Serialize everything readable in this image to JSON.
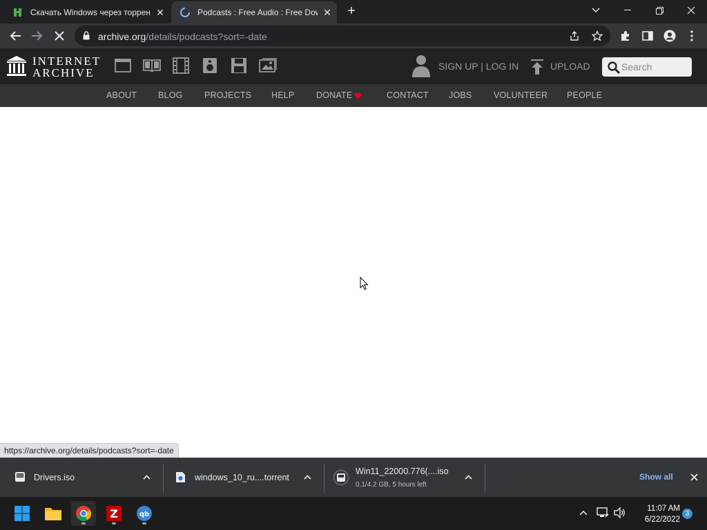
{
  "browser": {
    "tabs": [
      {
        "title": "Скачать Windows через торрент",
        "state": "inactive",
        "favicon": "torrent-site-icon"
      },
      {
        "title": "Podcasts : Free Audio : Free Download",
        "state": "active-loading",
        "favicon": "loading-spinner-icon"
      }
    ],
    "new_tab_label": "+",
    "window_controls": [
      "chevron-down-icon",
      "minimize-icon",
      "restore-icon",
      "close-icon"
    ],
    "url_host": "archive.org",
    "url_path": "/details/podcasts?sort=-date",
    "status_bubble": "https://archive.org/details/podcasts?sort=-date"
  },
  "ia": {
    "logo_line1": "INTERNET",
    "logo_line2": "ARCHIVE",
    "media_icons": [
      "web-icon",
      "texts-icon",
      "video-icon",
      "audio-icon",
      "software-icon",
      "images-icon"
    ],
    "signup_login": "SIGN UP | LOG IN",
    "upload": "UPLOAD",
    "search_placeholder": "Search",
    "nav": [
      "ABOUT",
      "BLOG",
      "PROJECTS",
      "HELP",
      "DONATE",
      "CONTACT",
      "JOBS",
      "VOLUNTEER",
      "PEOPLE"
    ],
    "donate_heart_color": "#e4002b"
  },
  "downloads": {
    "items": [
      {
        "name": "Drivers.iso",
        "sub": ""
      },
      {
        "name": "windows_10_ru....torrent",
        "sub": ""
      },
      {
        "name": "Win11_22000.776(....iso",
        "sub": "0.1/4.2 GB, 5 hours left"
      }
    ],
    "show_all": "Show all"
  },
  "taskbar": {
    "apps": [
      "windows-start-icon",
      "file-explorer-icon",
      "chrome-icon",
      "filezilla-icon",
      "qbittorrent-icon"
    ],
    "time": "11:07 AM",
    "date": "6/22/2022",
    "notification_count": "3"
  },
  "colors": {
    "accent_blue": "#8ab4f8",
    "ia_header": "#222222",
    "ia_nav": "#333333"
  }
}
